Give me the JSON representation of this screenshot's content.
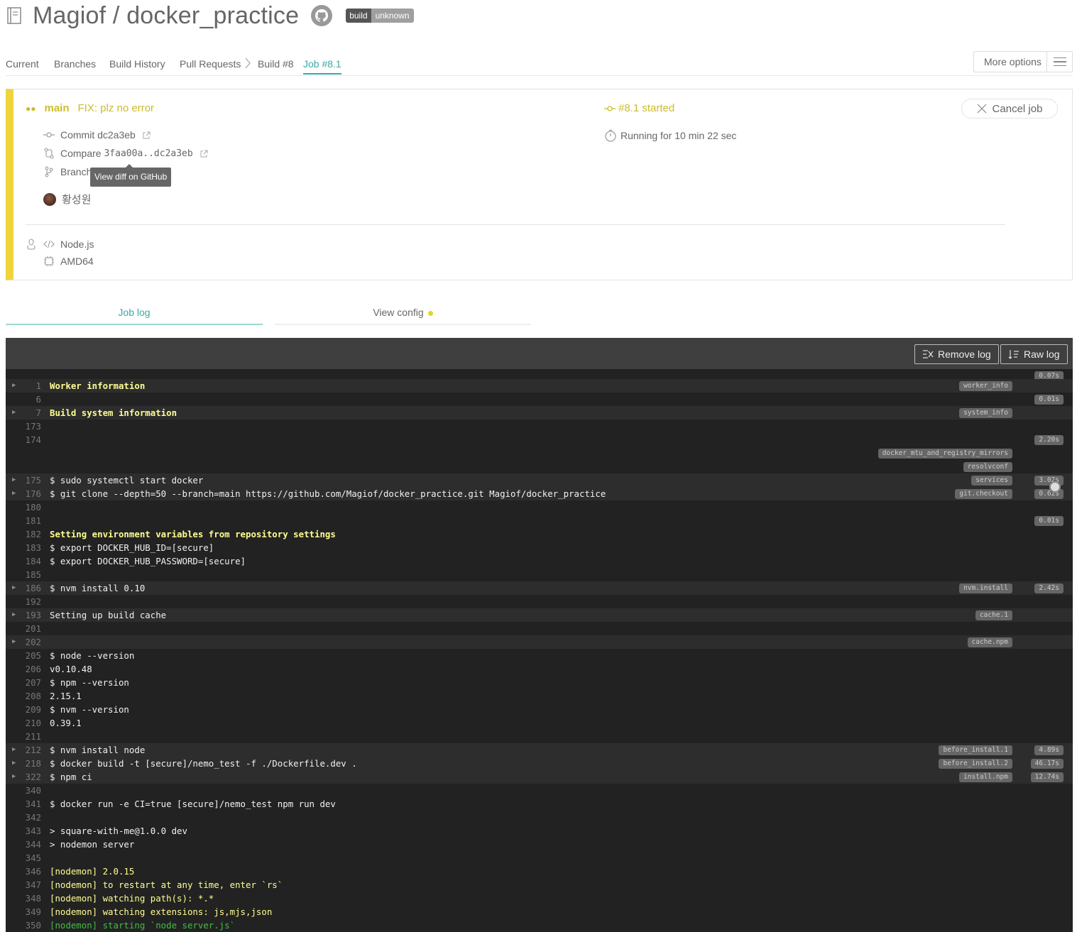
{
  "header": {
    "title": "Magiof / docker_practice",
    "badge_left": "build",
    "badge_right": "unknown"
  },
  "tabs": {
    "current": "Current",
    "branches": "Branches",
    "build_history": "Build History",
    "pull_requests": "Pull Requests",
    "build": "Build #8",
    "job": "Job #8.1",
    "more_options": "More options"
  },
  "job": {
    "branch": "main",
    "commit_message": "FIX: plz no error",
    "commit_label": "Commit dc2a3eb",
    "compare_label": "Compare",
    "compare_value": "3faa00a..dc2a3eb",
    "branch_label": "Branch",
    "tooltip": "View diff on GitHub",
    "author": "황성원",
    "language": "Node.js",
    "arch": "AMD64",
    "status": "#8.1 started",
    "running": "Running for 10 min 22 sec",
    "cancel": "Cancel job"
  },
  "log_tabs": {
    "job_log": "Job log",
    "view_config": "View config"
  },
  "log_toolbar": {
    "remove": "Remove log",
    "raw": "Raw log"
  },
  "log": {
    "t0": "0.07s",
    "l1n": "1",
    "l1t": "Worker information",
    "l1tag": "worker_info",
    "l6n": "6",
    "l6time": "0.01s",
    "l7n": "7",
    "l7t": "Build system information",
    "l7tag": "system_info",
    "l173n": "173",
    "l174n": "174",
    "l174time": "2.20s",
    "tag_mirrors": "docker_mtu_and_registry_mirrors",
    "tag_resolv": "resolvconf",
    "l175n": "175",
    "l175t": "$ sudo systemctl start docker",
    "l175tag": "services",
    "l175time": "3.02s",
    "l176n": "176",
    "l176t": "$ git clone --depth=50 --branch=main https://github.com/Magiof/docker_practice.git Magiof/docker_practice",
    "l176tag": "git.checkout",
    "l176time": "0.62s",
    "l180n": "180",
    "l181n": "181",
    "l181time": "0.01s",
    "l182n": "182",
    "l182t": "Setting environment variables from repository settings",
    "l183n": "183",
    "l183t": "$ export DOCKER_HUB_ID=[secure]",
    "l184n": "184",
    "l184t": "$ export DOCKER_HUB_PASSWORD=[secure]",
    "l185n": "185",
    "l186n": "186",
    "l186t": "$ nvm install 0.10",
    "l186tag": "nvm.install",
    "l186time": "2.42s",
    "l192n": "192",
    "l193n": "193",
    "l193t": "Setting up build cache",
    "l193tag": "cache.1",
    "l201n": "201",
    "l202n": "202",
    "l202tag": "cache.npm",
    "l205n": "205",
    "l205t": "$ node --version",
    "l206n": "206",
    "l206t": "v0.10.48",
    "l207n": "207",
    "l207t": "$ npm --version",
    "l208n": "208",
    "l208t": "2.15.1",
    "l209n": "209",
    "l209t": "$ nvm --version",
    "l210n": "210",
    "l210t": "0.39.1",
    "l211n": "211",
    "l212n": "212",
    "l212t": "$ nvm install node",
    "l212tag": "before_install.1",
    "l212time": "4.89s",
    "l218n": "218",
    "l218t": "$ docker build -t [secure]/nemo_test -f ./Dockerfile.dev .",
    "l218tag": "before_install.2",
    "l218time": "46.17s",
    "l322n": "322",
    "l322t": "$ npm ci",
    "l322tag": "install.npm",
    "l322time": "12.74s",
    "l340n": "340",
    "l341n": "341",
    "l341t": "$ docker run -e CI=true [secure]/nemo_test npm run dev",
    "l342n": "342",
    "l343n": "343",
    "l343t": "> square-with-me@1.0.0 dev",
    "l344n": "344",
    "l344t": "> nodemon server",
    "l345n": "345",
    "l346n": "346",
    "l346t": "[nodemon] 2.0.15",
    "l347n": "347",
    "l347t": "[nodemon] to restart at any time, enter `rs`",
    "l348n": "348",
    "l348t": "[nodemon] watching path(s): *.*",
    "l349n": "349",
    "l349t": "[nodemon] watching extensions: js,mjs,json",
    "l350n": "350",
    "l350t": "[nodemon] starting `node server.js`"
  }
}
